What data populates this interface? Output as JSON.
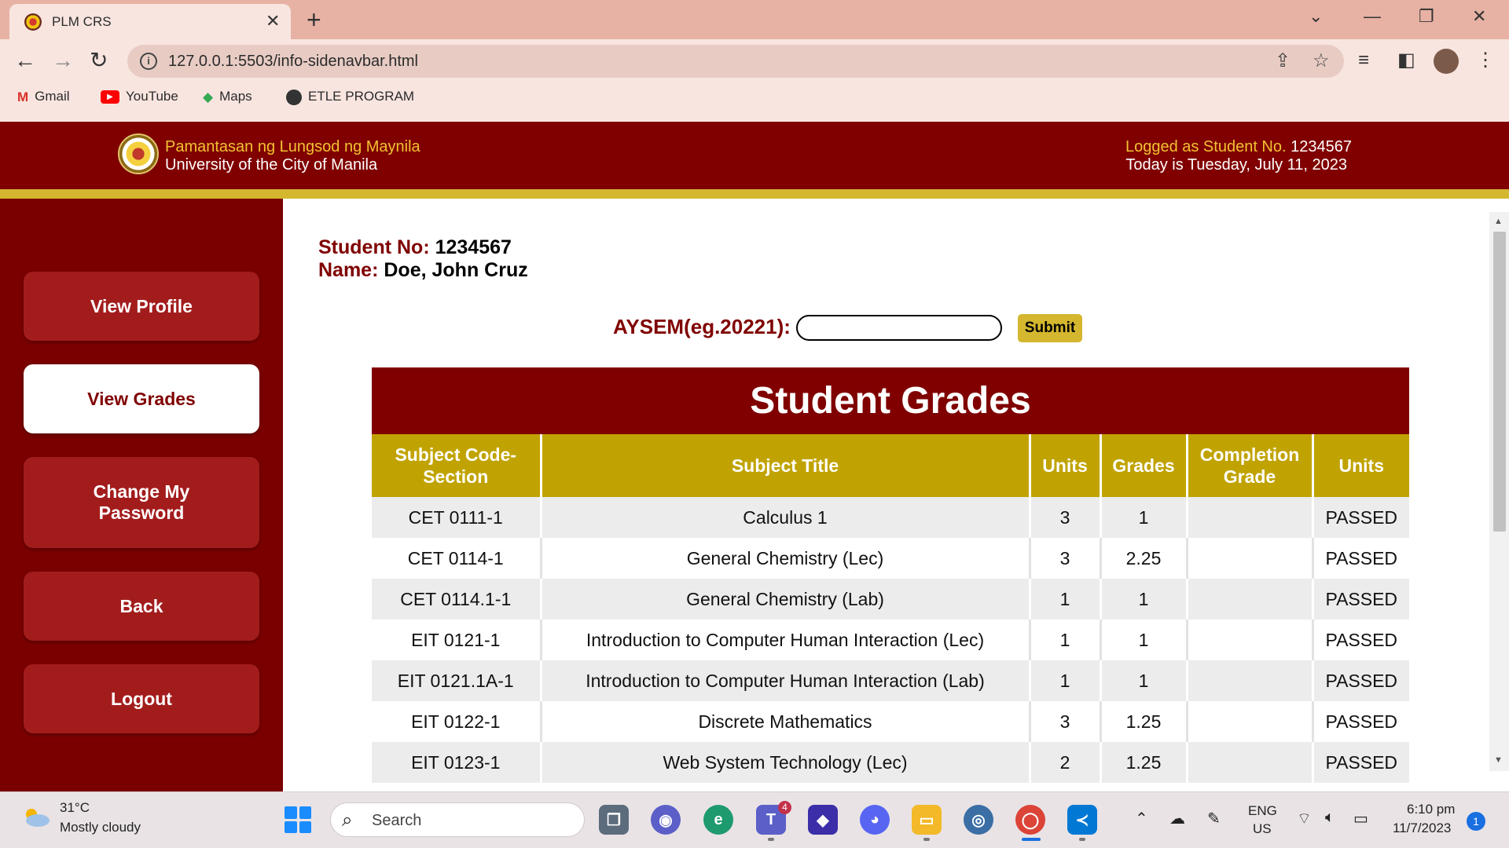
{
  "browser": {
    "tab_title": "PLM CRS",
    "url": "127.0.0.1:5503/info-sidenavbar.html",
    "bookmarks": [
      "Gmail",
      "YouTube",
      "Maps",
      "ETLE PROGRAM"
    ]
  },
  "header": {
    "univ_name": "Pamantasan ng Lungsod ng Maynila",
    "univ_name_en": "University of the City of Manila",
    "logged_label": "Logged as Student No.",
    "logged_number": "1234567",
    "today": "Today is Tuesday, July 11, 2023"
  },
  "sidebar": {
    "items": [
      {
        "label": "View Profile"
      },
      {
        "label": "View Grades"
      },
      {
        "label": "Change My Password"
      },
      {
        "label": "Back"
      },
      {
        "label": "Logout"
      }
    ]
  },
  "student": {
    "no_label": "Student No:",
    "no_value": "1234567",
    "name_label": "Name:",
    "name_value": "Doe, John Cruz"
  },
  "aysem": {
    "label": "AYSEM(eg.20221):",
    "value": "",
    "submit_label": "Submit"
  },
  "grades": {
    "title": "Student Grades",
    "columns": [
      "Subject Code-Section",
      "Subject Title",
      "Units",
      "Grades",
      "Completion Grade",
      "Units"
    ],
    "rows": [
      {
        "code": "CET 0111-1",
        "title": "Calculus 1",
        "units": "3",
        "grade": "1",
        "completion": "",
        "status": "PASSED"
      },
      {
        "code": "CET 0114-1",
        "title": "General Chemistry (Lec)",
        "units": "3",
        "grade": "2.25",
        "completion": "",
        "status": "PASSED"
      },
      {
        "code": "CET 0114.1-1",
        "title": "General Chemistry (Lab)",
        "units": "1",
        "grade": "1",
        "completion": "",
        "status": "PASSED"
      },
      {
        "code": "EIT 0121-1",
        "title": "Introduction to Computer Human Interaction (Lec)",
        "units": "1",
        "grade": "1",
        "completion": "",
        "status": "PASSED"
      },
      {
        "code": "EIT 0121.1A-1",
        "title": "Introduction to Computer Human Interaction (Lab)",
        "units": "1",
        "grade": "1",
        "completion": "",
        "status": "PASSED"
      },
      {
        "code": "EIT 0122-1",
        "title": "Discrete Mathematics",
        "units": "3",
        "grade": "1.25",
        "completion": "",
        "status": "PASSED"
      },
      {
        "code": "EIT 0123-1",
        "title": "Web System Technology (Lec)",
        "units": "2",
        "grade": "1.25",
        "completion": "",
        "status": "PASSED"
      }
    ]
  },
  "taskbar": {
    "temp": "31°C",
    "weather": "Mostly cloudy",
    "search_placeholder": "Search",
    "teams_badge": "4",
    "lang_top": "ENG",
    "lang_bottom": "US",
    "time": "6:10 pm",
    "date": "11/7/2023",
    "notifications": "1"
  }
}
